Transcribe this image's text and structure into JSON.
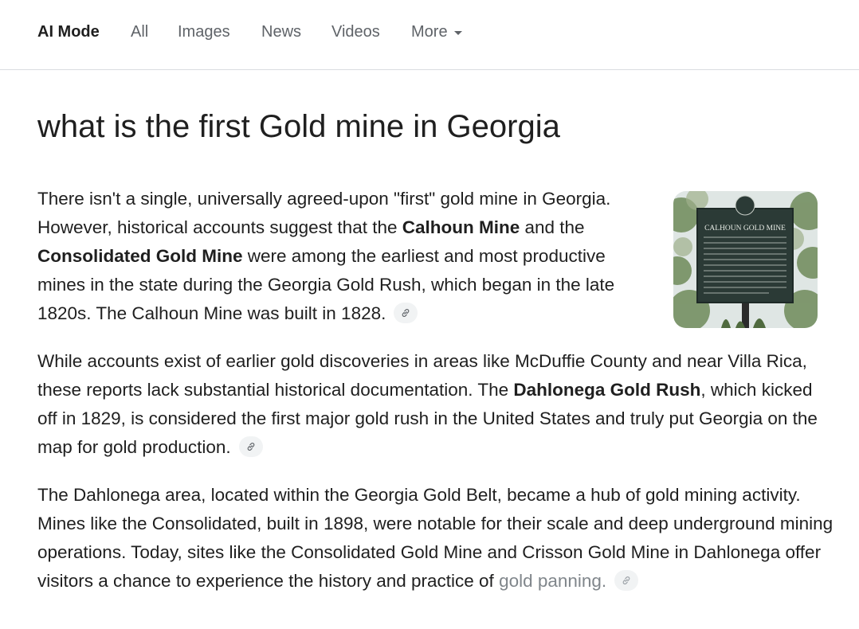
{
  "tabs": [
    {
      "label": "AI Mode",
      "active": true
    },
    {
      "label": "All"
    },
    {
      "label": "Images"
    },
    {
      "label": "News"
    },
    {
      "label": "Videos"
    },
    {
      "label": "More"
    }
  ],
  "query": "what is the first Gold mine in Georgia",
  "paragraphs": {
    "p1": {
      "t1": "There isn't a single, universally agreed-upon \"first\" gold mine in Georgia. However, historical accounts suggest that the ",
      "b1": "Calhoun Mine",
      "t2": " and the ",
      "b2": "Consolidated Gold Mine",
      "t3": " were among the earliest and most productive mines in the state during the Georgia Gold Rush, which began in the late 1820s. The Calhoun Mine was built in 1828."
    },
    "p2": {
      "t1": "While accounts exist of earlier gold discoveries in areas like McDuffie County and near Villa Rica, these reports lack substantial historical documentation. The ",
      "b1": "Dahlonega Gold Rush",
      "t2": ", which kicked off in 1829, is considered the first major gold rush in the United States and truly put Georgia on the map for gold production."
    },
    "p3": {
      "t1": "The Dahlonega area, located within the Georgia Gold Belt, became a hub of gold mining activity. Mines like the Consolidated, built in 1898, were notable for their scale and deep underground mining operations. Today, sites like the Consolidated Gold Mine and Crisson Gold Mine in Dahlonega offer visitors a chance to experience the history and practice of ",
      "t2": "gold panning."
    }
  },
  "image": {
    "sign_title": "CALHOUN GOLD MINE",
    "colors": {
      "sign": "#2b3a36",
      "foliage": "#6f8a5a",
      "sky": "#dfe6e4"
    }
  }
}
